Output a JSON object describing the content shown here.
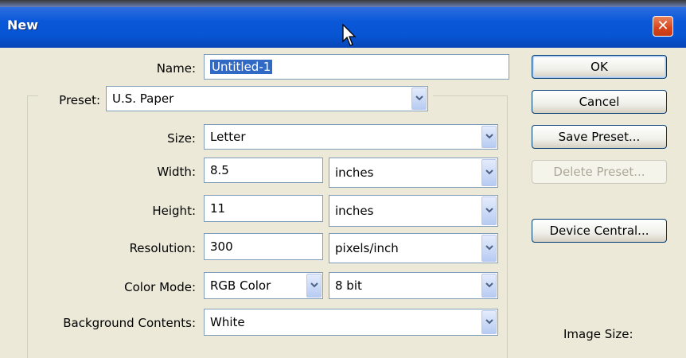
{
  "window": {
    "title": "New"
  },
  "form": {
    "name_label": "Name:",
    "name_value": "Untitled-1",
    "preset_label": "Preset:",
    "preset_value": "U.S. Paper",
    "size_label": "Size:",
    "size_value": "Letter",
    "width_label": "Width:",
    "width_value": "8.5",
    "width_unit": "inches",
    "height_label": "Height:",
    "height_value": "11",
    "height_unit": "inches",
    "resolution_label": "Resolution:",
    "resolution_value": "300",
    "resolution_unit": "pixels/inch",
    "color_mode_label": "Color Mode:",
    "color_mode_value": "RGB Color",
    "bit_depth_value": "8 bit",
    "background_label": "Background Contents:",
    "background_value": "White"
  },
  "buttons": {
    "ok": "OK",
    "cancel": "Cancel",
    "save_preset": "Save Preset...",
    "delete_preset": "Delete Preset...",
    "device_central": "Device Central..."
  },
  "info": {
    "image_size_label": "Image Size:"
  }
}
